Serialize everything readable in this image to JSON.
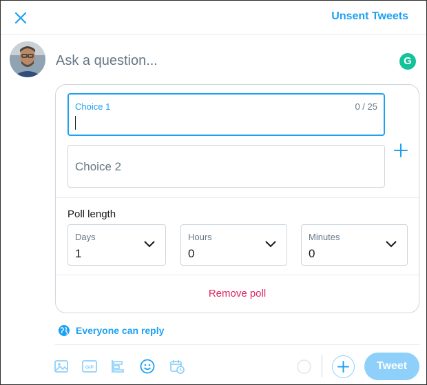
{
  "header": {
    "unsent_label": "Unsent Tweets"
  },
  "composer": {
    "placeholder": "Ask a question..."
  },
  "poll": {
    "choice1": {
      "label": "Choice 1",
      "counter": "0 / 25"
    },
    "choice2": {
      "label": "Choice 2"
    },
    "length_label": "Poll length",
    "days": {
      "label": "Days",
      "value": "1"
    },
    "hours": {
      "label": "Hours",
      "value": "0"
    },
    "minutes": {
      "label": "Minutes",
      "value": "0"
    },
    "remove_label": "Remove poll"
  },
  "reply": {
    "label": "Everyone can reply"
  },
  "toolbar": {
    "icons": [
      "image-icon",
      "gif-icon",
      "poll-icon",
      "emoji-icon",
      "schedule-icon"
    ],
    "tweet_label": "Tweet"
  },
  "colors": {
    "accent": "#1da1f2",
    "danger": "#e0245e",
    "accent_disabled": "#8ed0f9"
  }
}
